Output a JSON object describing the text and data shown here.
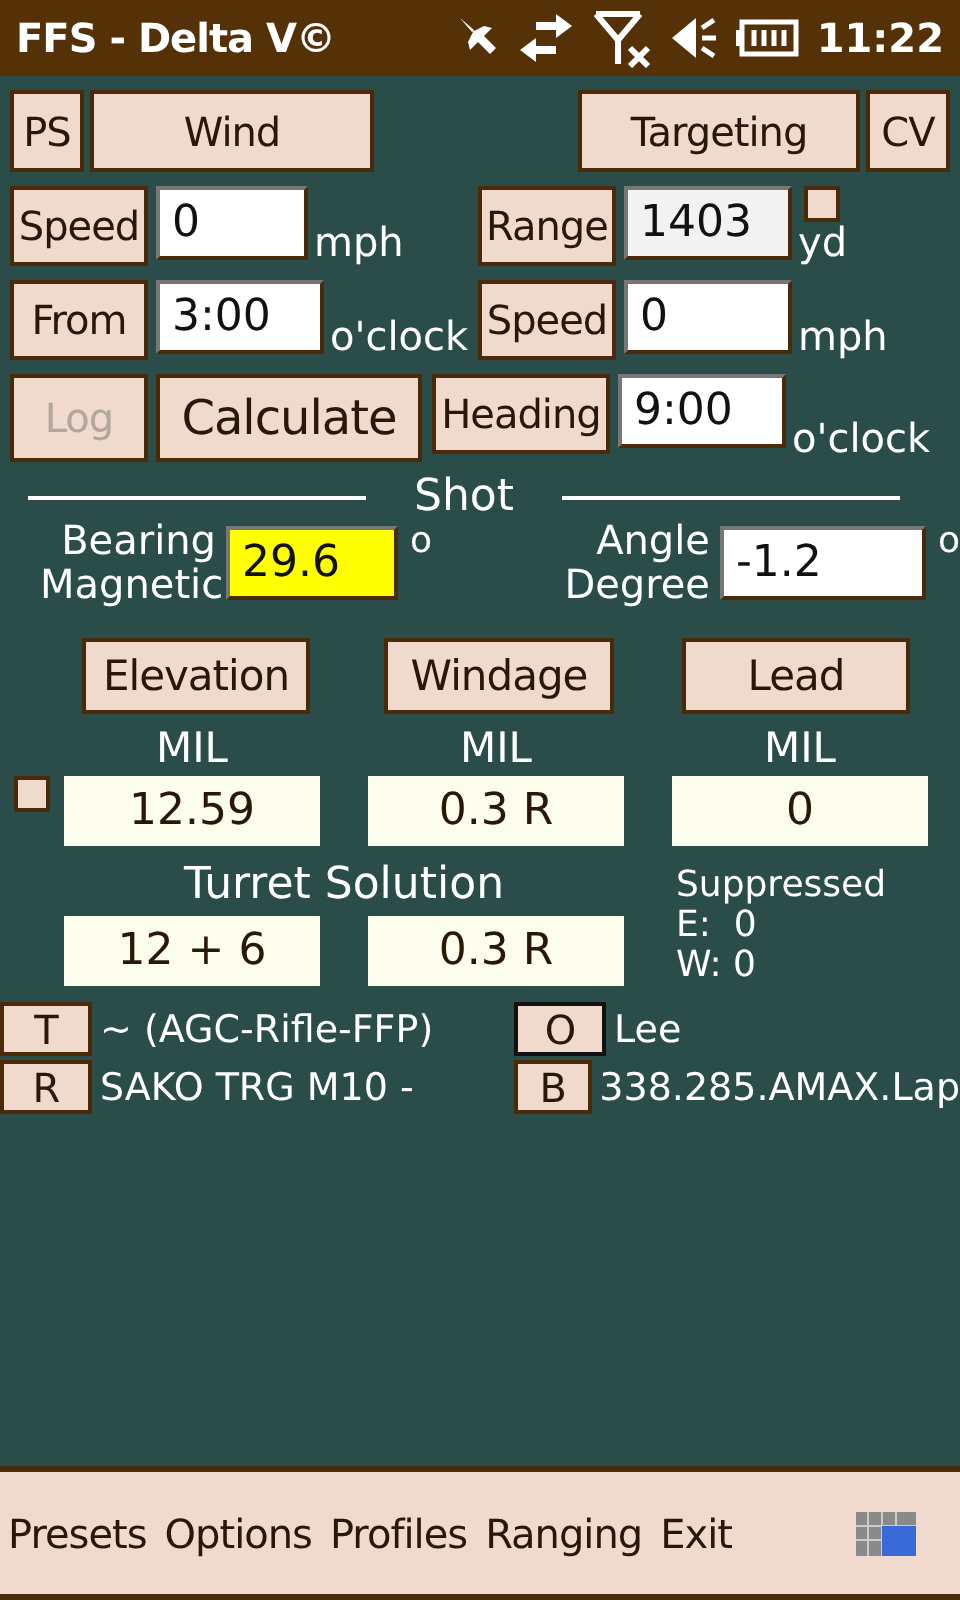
{
  "status_bar": {
    "title": "FFS - Delta V©",
    "time": "11:22"
  },
  "top_buttons": [
    {
      "label": "PS"
    },
    {
      "label": "Wind"
    },
    {
      "label": "Targeting"
    },
    {
      "label": "CV"
    }
  ],
  "wind_fields": [
    {
      "button": "Speed",
      "value": "0",
      "unit": "mph"
    },
    {
      "button": "From",
      "value": "3:00",
      "unit": "o'clock"
    }
  ],
  "actions": [
    {
      "label": "Log",
      "disabled": true
    },
    {
      "label": "Calculate",
      "disabled": false
    }
  ],
  "target_fields": [
    {
      "button": "Range",
      "value": "1403",
      "unit": "yd",
      "readonly": true,
      "checkbox": {
        "checked": false
      }
    },
    {
      "button": "Speed",
      "value": "0",
      "unit": "mph",
      "readonly": false
    },
    {
      "button": "Heading",
      "value": "9:00",
      "unit": "o'clock",
      "readonly": false
    }
  ],
  "shot": {
    "title": "Shot",
    "fields": [
      {
        "label_lines": [
          "Bearing",
          "Magnetic"
        ],
        "value": "29.6",
        "unit": "o",
        "highlighted": true
      },
      {
        "label_lines": [
          "Angle",
          "Degree"
        ],
        "value": "-1.2",
        "unit": "o",
        "highlighted": false
      }
    ]
  },
  "solution": {
    "checkbox": {
      "checked": false
    },
    "columns": [
      {
        "button": "Elevation",
        "unit": "MIL",
        "value": "12.59"
      },
      {
        "button": "Windage",
        "unit": "MIL",
        "value": "0.3 R"
      },
      {
        "button": "Lead",
        "unit": "MIL",
        "value": "0"
      }
    ],
    "turret": {
      "title": "Turret Solution",
      "values": [
        "12 + 6",
        "0.3 R"
      ]
    },
    "suppressed": {
      "title": "Suppressed",
      "lines": [
        "E:  0",
        "W: 0"
      ]
    }
  },
  "profiles": [
    {
      "button": "T",
      "text": "~ (AGC-Rifle-FFP)",
      "focused": false
    },
    {
      "button": "O",
      "text": "Lee",
      "focused": true
    },
    {
      "button": "R",
      "text": "SAKO TRG M10 -",
      "focused": false
    },
    {
      "button": "B",
      "text": "338.285.AMAX.Lap",
      "focused": false
    }
  ],
  "menu": [
    "Presets",
    "Options",
    "Profiles",
    "Ranging",
    "Exit"
  ]
}
